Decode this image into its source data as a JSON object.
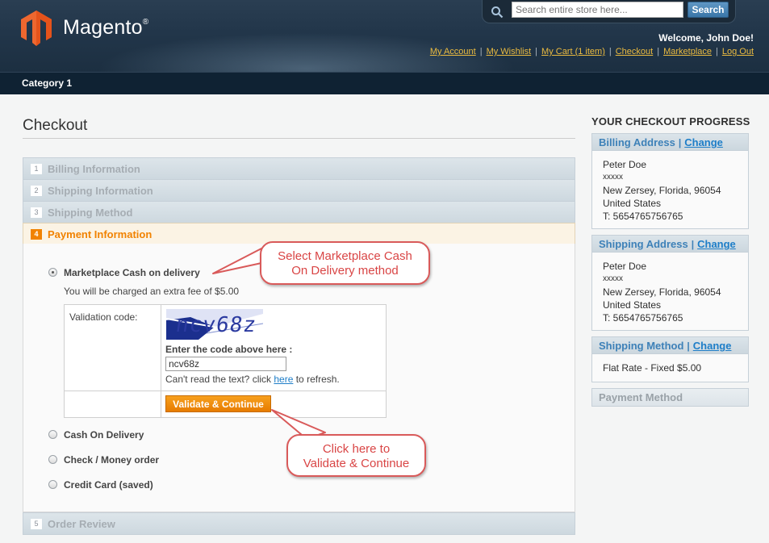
{
  "header": {
    "logo_text": "Magento",
    "logo_mark": "®",
    "search": {
      "placeholder": "Search entire store here...",
      "button_label": "Search"
    },
    "welcome": "Welcome, John Doe!",
    "links": [
      "My Account",
      "My Wishlist",
      "My Cart (1 item)",
      "Checkout",
      "Marketplace",
      "Log Out"
    ]
  },
  "nav": {
    "items": [
      "Category 1"
    ]
  },
  "page": {
    "title": "Checkout"
  },
  "steps": [
    {
      "num": "1",
      "label": "Billing Information"
    },
    {
      "num": "2",
      "label": "Shipping Information"
    },
    {
      "num": "3",
      "label": "Shipping Method"
    },
    {
      "num": "4",
      "label": "Payment Information"
    },
    {
      "num": "5",
      "label": "Order Review"
    }
  ],
  "payment": {
    "methods": [
      "Marketplace Cash on delivery",
      "Cash On Delivery",
      "Check / Money order",
      "Credit Card (saved)"
    ],
    "selected": "Marketplace Cash on delivery",
    "fee_note": "You will be charged an extra fee of $5.00",
    "validation_label": "Validation code:",
    "captcha_text": "ncv68z",
    "enter_code_label": "Enter the code above here :",
    "code_value": "ncv68z",
    "refresh_prefix": "Can't read the text? click ",
    "refresh_link": "here",
    "refresh_suffix": " to refresh.",
    "validate_button": "Validate & Continue"
  },
  "callouts": {
    "select": [
      "Select Marketplace Cash",
      "On Delivery method"
    ],
    "click": [
      "Click here to",
      "Validate & Continue"
    ]
  },
  "sidebar": {
    "title": "YOUR CHECKOUT PROGRESS",
    "change_label": "Change",
    "sep": "|",
    "billing": {
      "title": "Billing Address",
      "lines": [
        "Peter Doe",
        "xxxxx",
        "New Zersey, Florida, 96054",
        "United States",
        "T: 5654765756765"
      ]
    },
    "shipping": {
      "title": "Shipping Address",
      "lines": [
        "Peter Doe",
        "xxxxx",
        "New Zersey, Florida, 96054",
        "United States",
        "T: 5654765756765"
      ]
    },
    "shipping_method": {
      "title": "Shipping Method",
      "value": "Flat Rate - Fixed $5.00"
    },
    "payment_method": {
      "title": "Payment Method"
    }
  },
  "colors": {
    "accent_orange": "#f18200",
    "link_blue": "#1e7ec8",
    "callout_red": "#d94545",
    "header_navy": "#22364a"
  }
}
